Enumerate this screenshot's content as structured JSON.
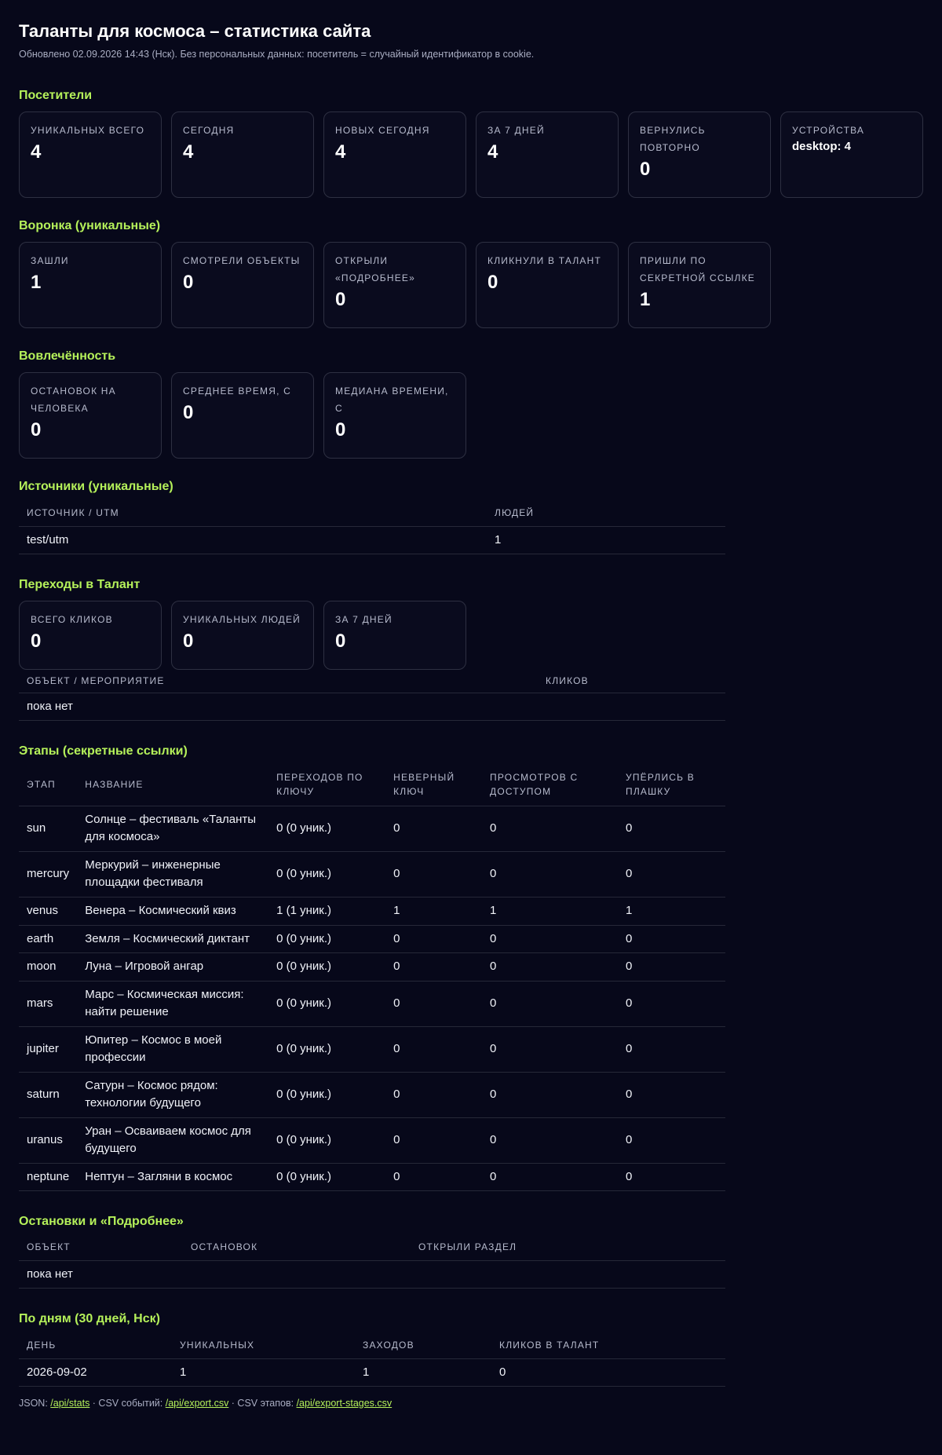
{
  "header": {
    "title": "Таланты для космоса – статистика сайта",
    "subtitle": "Обновлено 02.09.2026 14:43 (Нск). Без персональных данных: посетитель = случайный идентификатор в cookie."
  },
  "colors": {
    "accent": "#b5f15a",
    "background": "#07081a",
    "card_border": "#2e3042"
  },
  "visitors": {
    "title": "Посетители",
    "cards": [
      {
        "label": "Уникальных всего",
        "value": "4"
      },
      {
        "label": "Сегодня",
        "value": "4"
      },
      {
        "label": "Новых сегодня",
        "value": "4"
      },
      {
        "label": "За 7 дней",
        "value": "4"
      },
      {
        "label": "Вернулись повторно",
        "value": "0"
      },
      {
        "label": "Устройства",
        "value": "desktop: 4"
      }
    ]
  },
  "funnel": {
    "title": "Воронка (уникальные)",
    "cards": [
      {
        "label": "Зашли",
        "value": "1"
      },
      {
        "label": "Смотрели объекты",
        "value": "0"
      },
      {
        "label": "Открыли «Подробнее»",
        "value": "0"
      },
      {
        "label": "Кликнули в Талант",
        "value": "0"
      },
      {
        "label": "Пришли по секретной ссылке",
        "value": "1"
      }
    ]
  },
  "engagement": {
    "title": "Вовлечённость",
    "cards": [
      {
        "label": "Остановок на человека",
        "value": "0"
      },
      {
        "label": "Среднее время, с",
        "value": "0"
      },
      {
        "label": "Медиана времени, с",
        "value": "0"
      }
    ]
  },
  "sources": {
    "title": "Источники (уникальные)",
    "columns": [
      "Источник / UTM",
      "Людей"
    ],
    "rows": [
      [
        "test/utm",
        "1"
      ]
    ]
  },
  "talent": {
    "title": "Переходы в Талант",
    "cards": [
      {
        "label": "Всего кликов",
        "value": "0"
      },
      {
        "label": "Уникальных людей",
        "value": "0"
      },
      {
        "label": "За 7 дней",
        "value": "0"
      }
    ],
    "columns": [
      "Объект / мероприятие",
      "Кликов"
    ],
    "empty": "пока нет"
  },
  "stages": {
    "title": "Этапы (секретные ссылки)",
    "columns": [
      "Этап",
      "Название",
      "Переходов по ключу",
      "Неверный ключ",
      "Просмотров с доступом",
      "Упёрлись в плашку"
    ],
    "rows": [
      [
        "sun",
        "Солнце – фестиваль «Таланты для космоса»",
        "0 (0 уник.)",
        "0",
        "0",
        "0"
      ],
      [
        "mercury",
        "Меркурий – инженерные площадки фестиваля",
        "0 (0 уник.)",
        "0",
        "0",
        "0"
      ],
      [
        "venus",
        "Венера – Космический квиз",
        "1 (1 уник.)",
        "1",
        "1",
        "1"
      ],
      [
        "earth",
        "Земля – Космический диктант",
        "0 (0 уник.)",
        "0",
        "0",
        "0"
      ],
      [
        "moon",
        "Луна – Игровой ангар",
        "0 (0 уник.)",
        "0",
        "0",
        "0"
      ],
      [
        "mars",
        "Марс – Космическая миссия: найти решение",
        "0 (0 уник.)",
        "0",
        "0",
        "0"
      ],
      [
        "jupiter",
        "Юпитер – Космос в моей профессии",
        "0 (0 уник.)",
        "0",
        "0",
        "0"
      ],
      [
        "saturn",
        "Сатурн – Космос рядом: технологии будущего",
        "0 (0 уник.)",
        "0",
        "0",
        "0"
      ],
      [
        "uranus",
        "Уран – Осваиваем космос для будущего",
        "0 (0 уник.)",
        "0",
        "0",
        "0"
      ],
      [
        "neptune",
        "Нептун – Загляни в космос",
        "0 (0 уник.)",
        "0",
        "0",
        "0"
      ]
    ]
  },
  "stops": {
    "title": "Остановки и «Подробнее»",
    "columns": [
      "Объект",
      "Остановок",
      "Открыли раздел"
    ],
    "empty": "пока нет"
  },
  "daily": {
    "title": "По дням (30 дней, Нск)",
    "columns": [
      "День",
      "Уникальных",
      "Заходов",
      "Кликов в Талант"
    ],
    "rows": [
      [
        "2026-09-02",
        "1",
        "1",
        "0"
      ]
    ]
  },
  "footer": {
    "json_label": "JSON: ",
    "json_link": "/api/stats",
    "csv_events_label": " · CSV событий: ",
    "csv_events_link": "/api/export.csv",
    "csv_stages_label": " · CSV этапов: ",
    "csv_stages_link": "/api/export-stages.csv"
  }
}
